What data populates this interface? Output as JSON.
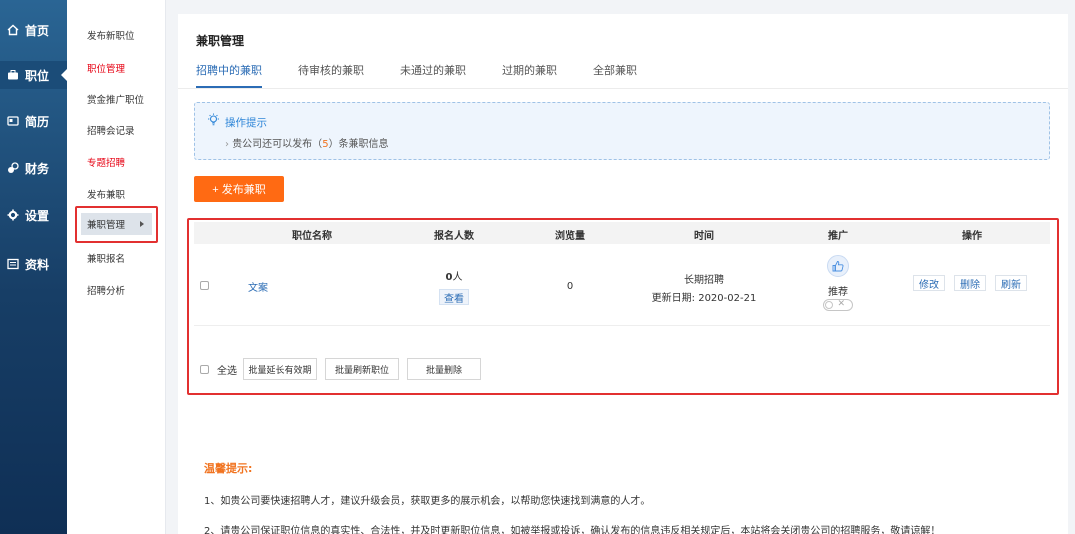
{
  "sidebar": {
    "items": [
      {
        "label": "首页",
        "icon": "home-icon"
      },
      {
        "label": "职位",
        "icon": "briefcase-icon"
      },
      {
        "label": "简历",
        "icon": "resume-icon"
      },
      {
        "label": "财务",
        "icon": "finance-icon"
      },
      {
        "label": "设置",
        "icon": "gear-icon"
      },
      {
        "label": "资料",
        "icon": "profile-icon"
      }
    ]
  },
  "subnav": {
    "items": [
      {
        "label": "发布新职位"
      },
      {
        "label": "职位管理"
      },
      {
        "label": "赏金推广职位"
      },
      {
        "label": "招聘会记录"
      },
      {
        "label": "专题招聘"
      },
      {
        "label": "发布兼职"
      },
      {
        "label": "兼职管理"
      },
      {
        "label": "兼职报名"
      },
      {
        "label": "招聘分析"
      }
    ]
  },
  "page": {
    "title": "兼职管理",
    "tabs": [
      "招聘中的兼职",
      "待审核的兼职",
      "未通过的兼职",
      "过期的兼职",
      "全部兼职"
    ]
  },
  "tip": {
    "title": "操作提示",
    "line_prefix": "贵公司还可以发布（",
    "count": "5",
    "line_suffix": "）条兼职信息"
  },
  "post_button": "+ 发布兼职",
  "table": {
    "headers": [
      "职位名称",
      "报名人数",
      "浏览量",
      "时间",
      "推广",
      "操作"
    ],
    "rows": [
      {
        "name": "文案",
        "applicants": "0",
        "applicants_unit": "人",
        "view_label": "查看",
        "views": "0",
        "time_type": "长期招聘",
        "updated": "更新日期: 2020-02-21",
        "promote_label": "推荐",
        "actions": [
          "修改",
          "删除",
          "刷新"
        ]
      }
    ]
  },
  "batch": {
    "select_all": "全选",
    "extend": "批量延长有效期",
    "refresh": "批量刷新职位",
    "delete": "批量删除"
  },
  "warm": {
    "title": "温馨提示:",
    "lines": [
      "1、如贵公司要快速招聘人才，建议升级会员，获取更多的展示机会，以帮助您快速找到满意的人才。",
      "2、请贵公司保证职位信息的真实性、合法性，并及时更新职位信息，如被举报或投诉，确认发布的信息违反相关规定后，本站将会关闭贵公司的招聘服务，敬请谅解！"
    ]
  },
  "colors": {
    "accent": "#2b6cb5",
    "orange": "#ff6a13",
    "highlight_red": "#e23030",
    "nav_dark": "#173e66"
  }
}
